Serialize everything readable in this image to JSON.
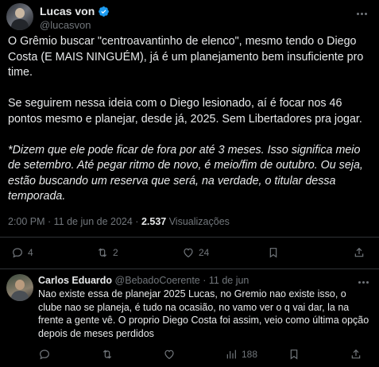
{
  "tweet": {
    "author_name": "Lucas von",
    "author_handle": "@lucasvon",
    "paragraphs": [
      "O Grêmio buscar \"centroavantinho de elenco\", mesmo tendo o Diego Costa (E MAIS NINGUÉM), já é um planejamento bem insuficiente pro time.",
      "Se seguirem nessa ideia com o Diego lesionado, aí é focar nos 46 pontos mesmo e planejar, desde já, 2025. Sem Libertadores pra jogar.",
      "*Dizem que ele pode ficar de fora por até 3 meses. Isso significa meio de setembro. Até pegar ritmo de novo, é meio/fim de outubro. Ou seja, estão buscando um reserva que será, na verdade, o titular dessa temporada."
    ],
    "timestamp": "2:00 PM · 11 de jun de 2024 · ",
    "views_count": "2.537",
    "views_label": " Visualizações",
    "actions": {
      "replies": "4",
      "retweets": "2",
      "likes": "24"
    }
  },
  "reply": {
    "author_name": "Carlos Eduardo",
    "author_handle_date": " @BebadoCoerente · 11 de jun",
    "text": "Nao existe essa de planejar 2025 Lucas, no Gremio nao existe isso, o clube nao se planeja, é tudo na ocasião, no vamo ver o q vai dar, la na frente a gente vê. O proprio Diego Costa foi assim, veio como última opção depois de meses perdidos",
    "actions": {
      "views": "188"
    }
  },
  "colors": {
    "background": "#000000",
    "text": "#e7e9ea",
    "muted": "#71767b",
    "divider": "#2f3336",
    "verified": "#1d9bf0"
  }
}
